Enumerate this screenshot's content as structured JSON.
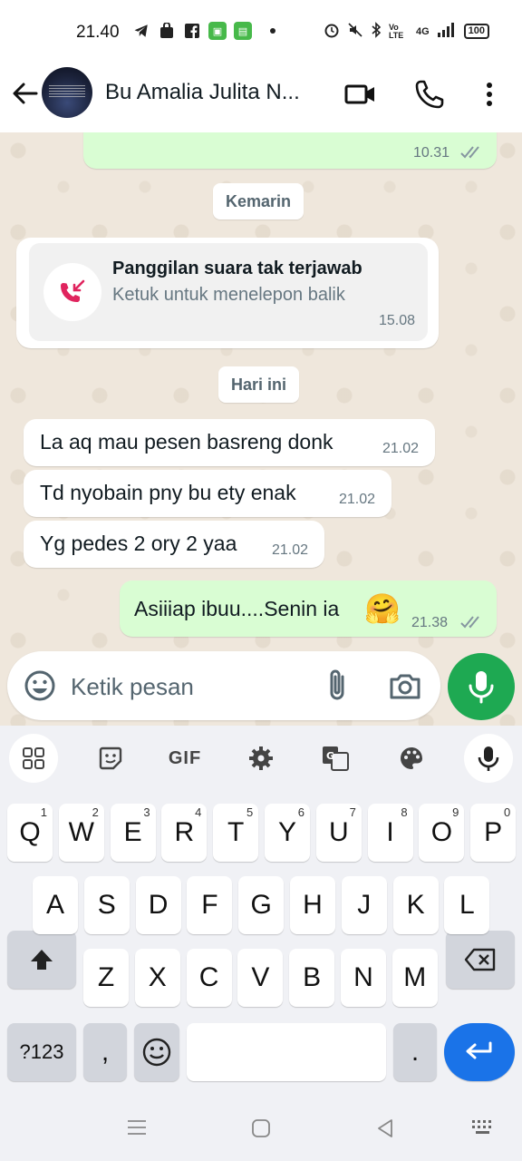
{
  "status_bar": {
    "time": "21.40",
    "network": "4G",
    "volte": "Vo LTE",
    "battery": "100"
  },
  "header": {
    "contact_name": "Bu Amalia Julita N..."
  },
  "chat": {
    "top_bubble_time": "10.31",
    "date_yesterday": "Kemarin",
    "missed_call": {
      "title": "Panggilan suara tak terjawab",
      "subtitle": "Ketuk untuk menelepon balik",
      "time": "15.08"
    },
    "date_today": "Hari ini",
    "messages": [
      {
        "text": "La aq mau pesen basreng donk",
        "time": "21.02",
        "direction": "in"
      },
      {
        "text": "Td nyobain pny bu ety enak",
        "time": "21.02",
        "direction": "in"
      },
      {
        "text": "Yg pedes 2 ory 2 yaa",
        "time": "21.02",
        "direction": "in"
      },
      {
        "text": "Asiiiap ibuu....Senin ia",
        "emoji": "🤗",
        "time": "21.38",
        "direction": "out"
      }
    ]
  },
  "input": {
    "placeholder": "Ketik pesan"
  },
  "keyboard": {
    "toolbar": {
      "gif": "GIF"
    },
    "row1": [
      {
        "k": "Q",
        "n": "1"
      },
      {
        "k": "W",
        "n": "2"
      },
      {
        "k": "E",
        "n": "3"
      },
      {
        "k": "R",
        "n": "4"
      },
      {
        "k": "T",
        "n": "5"
      },
      {
        "k": "Y",
        "n": "6"
      },
      {
        "k": "U",
        "n": "7"
      },
      {
        "k": "I",
        "n": "8"
      },
      {
        "k": "O",
        "n": "9"
      },
      {
        "k": "P",
        "n": "0"
      }
    ],
    "row2": [
      "A",
      "S",
      "D",
      "F",
      "G",
      "H",
      "J",
      "K",
      "L"
    ],
    "row3": [
      "Z",
      "X",
      "C",
      "V",
      "B",
      "N",
      "M"
    ],
    "symbols_key": "?123",
    "comma_key": ",",
    "period_key": "."
  },
  "colors": {
    "chat_bg": "#efe7dc",
    "out_bubble": "#d9fdd3",
    "accent_green": "#1ea952",
    "enter_blue": "#1a73e8",
    "missed_red": "#e0245e"
  }
}
